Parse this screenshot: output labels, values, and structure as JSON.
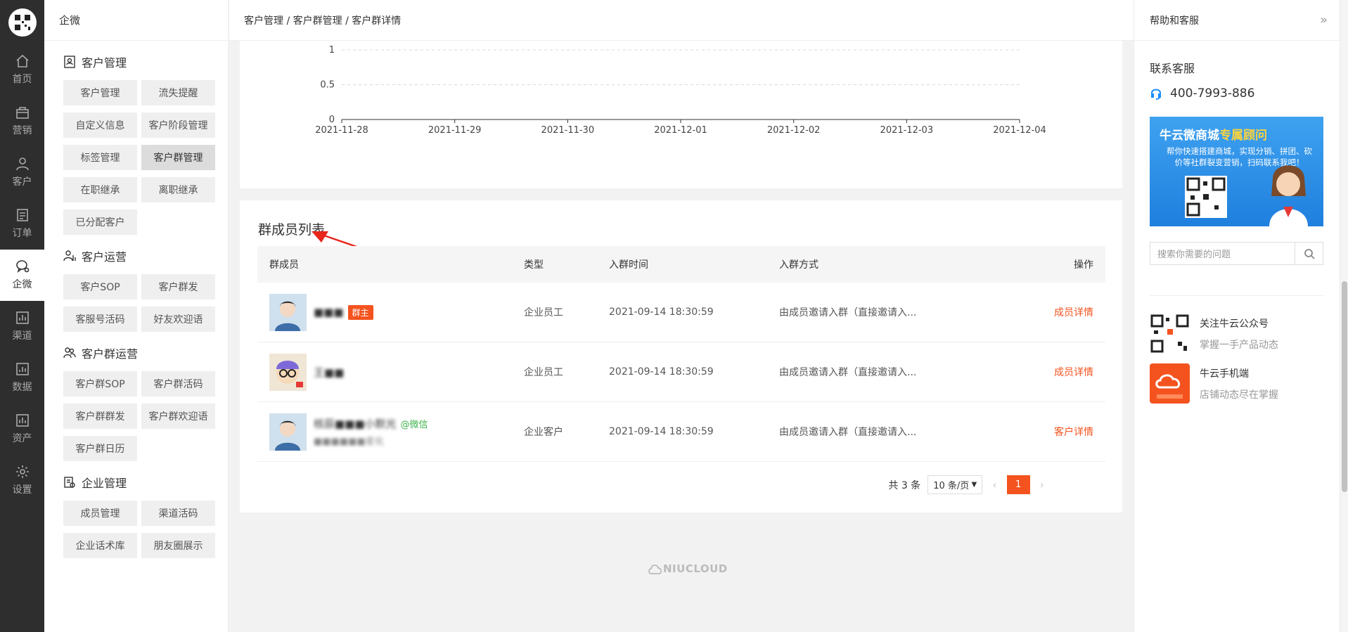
{
  "rail": {
    "items": [
      {
        "label": "首页",
        "icon": "home-icon"
      },
      {
        "label": "营销",
        "icon": "marketing-icon"
      },
      {
        "label": "客户",
        "icon": "customer-icon"
      },
      {
        "label": "订单",
        "icon": "order-icon"
      },
      {
        "label": "企微",
        "icon": "wecom-icon",
        "active": true
      },
      {
        "label": "渠道",
        "icon": "channel-icon"
      },
      {
        "label": "数据",
        "icon": "data-icon"
      },
      {
        "label": "资产",
        "icon": "asset-icon"
      },
      {
        "label": "设置",
        "icon": "settings-icon"
      }
    ]
  },
  "sidebar": {
    "title": "企微",
    "groups": [
      {
        "title": "客户管理",
        "items": [
          "客户管理",
          "流失提醒",
          "自定义信息",
          "客户阶段管理",
          "标签管理",
          "客户群管理",
          "在职继承",
          "离职继承",
          "已分配客户"
        ]
      },
      {
        "title": "客户运营",
        "items": [
          "客户SOP",
          "客户群发",
          "客服号活码",
          "好友欢迎语"
        ]
      },
      {
        "title": "客户群运营",
        "items": [
          "客户群SOP",
          "客户群活码",
          "客户群群发",
          "客户群欢迎语",
          "客户群日历"
        ]
      },
      {
        "title": "企业管理",
        "items": [
          "成员管理",
          "渠道活码",
          "企业话术库",
          "朋友圈展示"
        ]
      }
    ],
    "active_item": "客户群管理"
  },
  "breadcrumb": "客户管理 / 客户群管理 / 客户群详情",
  "chart_data": {
    "type": "line",
    "x": [
      "2021-11-28",
      "2021-11-29",
      "2021-11-30",
      "2021-12-01",
      "2021-12-02",
      "2021-12-03",
      "2021-12-04"
    ],
    "y_ticks": [
      "0",
      "0.5",
      "1"
    ],
    "ylim": [
      0,
      1
    ],
    "grid": true,
    "series": []
  },
  "members": {
    "title": "群成员列表",
    "columns": [
      "群成员",
      "类型",
      "入群时间",
      "入群方式",
      "操作"
    ],
    "rows": [
      {
        "name": "■■■",
        "badge": "群主",
        "type": "企业员工",
        "time": "2021-09-14 18:30:59",
        "method": "由成员邀请入群（直接邀请入...",
        "action": "成员详情"
      },
      {
        "name": "王■■",
        "badge": "",
        "type": "企业员工",
        "time": "2021-09-14 18:30:59",
        "method": "由成员邀请入群（直接邀请入...",
        "action": "成员详情"
      },
      {
        "name": "核辰■■■小默光",
        "wechat": "@微信",
        "name2": "■■■■■■星化",
        "type": "企业客户",
        "time": "2021-09-14 18:30:59",
        "method": "由成员邀请入群（直接邀请入...",
        "action": "客户详情"
      }
    ],
    "pagination": {
      "total": "共 3 条",
      "page_size": "10 条/页",
      "current": "1"
    }
  },
  "footer_logo": "NIUCLOUD",
  "help": {
    "title": "帮助和客服",
    "contact_title": "联系客服",
    "phone": "400-7993-886",
    "banner_title_a": "牛云微商城",
    "banner_title_b": "专属顾问",
    "banner_sub": "帮你快速搭建商城，实现分销、拼团、砍价等社群裂变营销，扫码联系我吧！",
    "search_placeholder": "搜索你需要的问题",
    "promos": [
      {
        "title": "关注牛云公众号",
        "sub": "掌握一手产品动态"
      },
      {
        "title": "牛云手机端",
        "sub": "店铺动态尽在掌握"
      }
    ]
  },
  "colors": {
    "accent": "#f4531f",
    "rail": "#2e2e2e",
    "wechat": "#3bb24a"
  }
}
